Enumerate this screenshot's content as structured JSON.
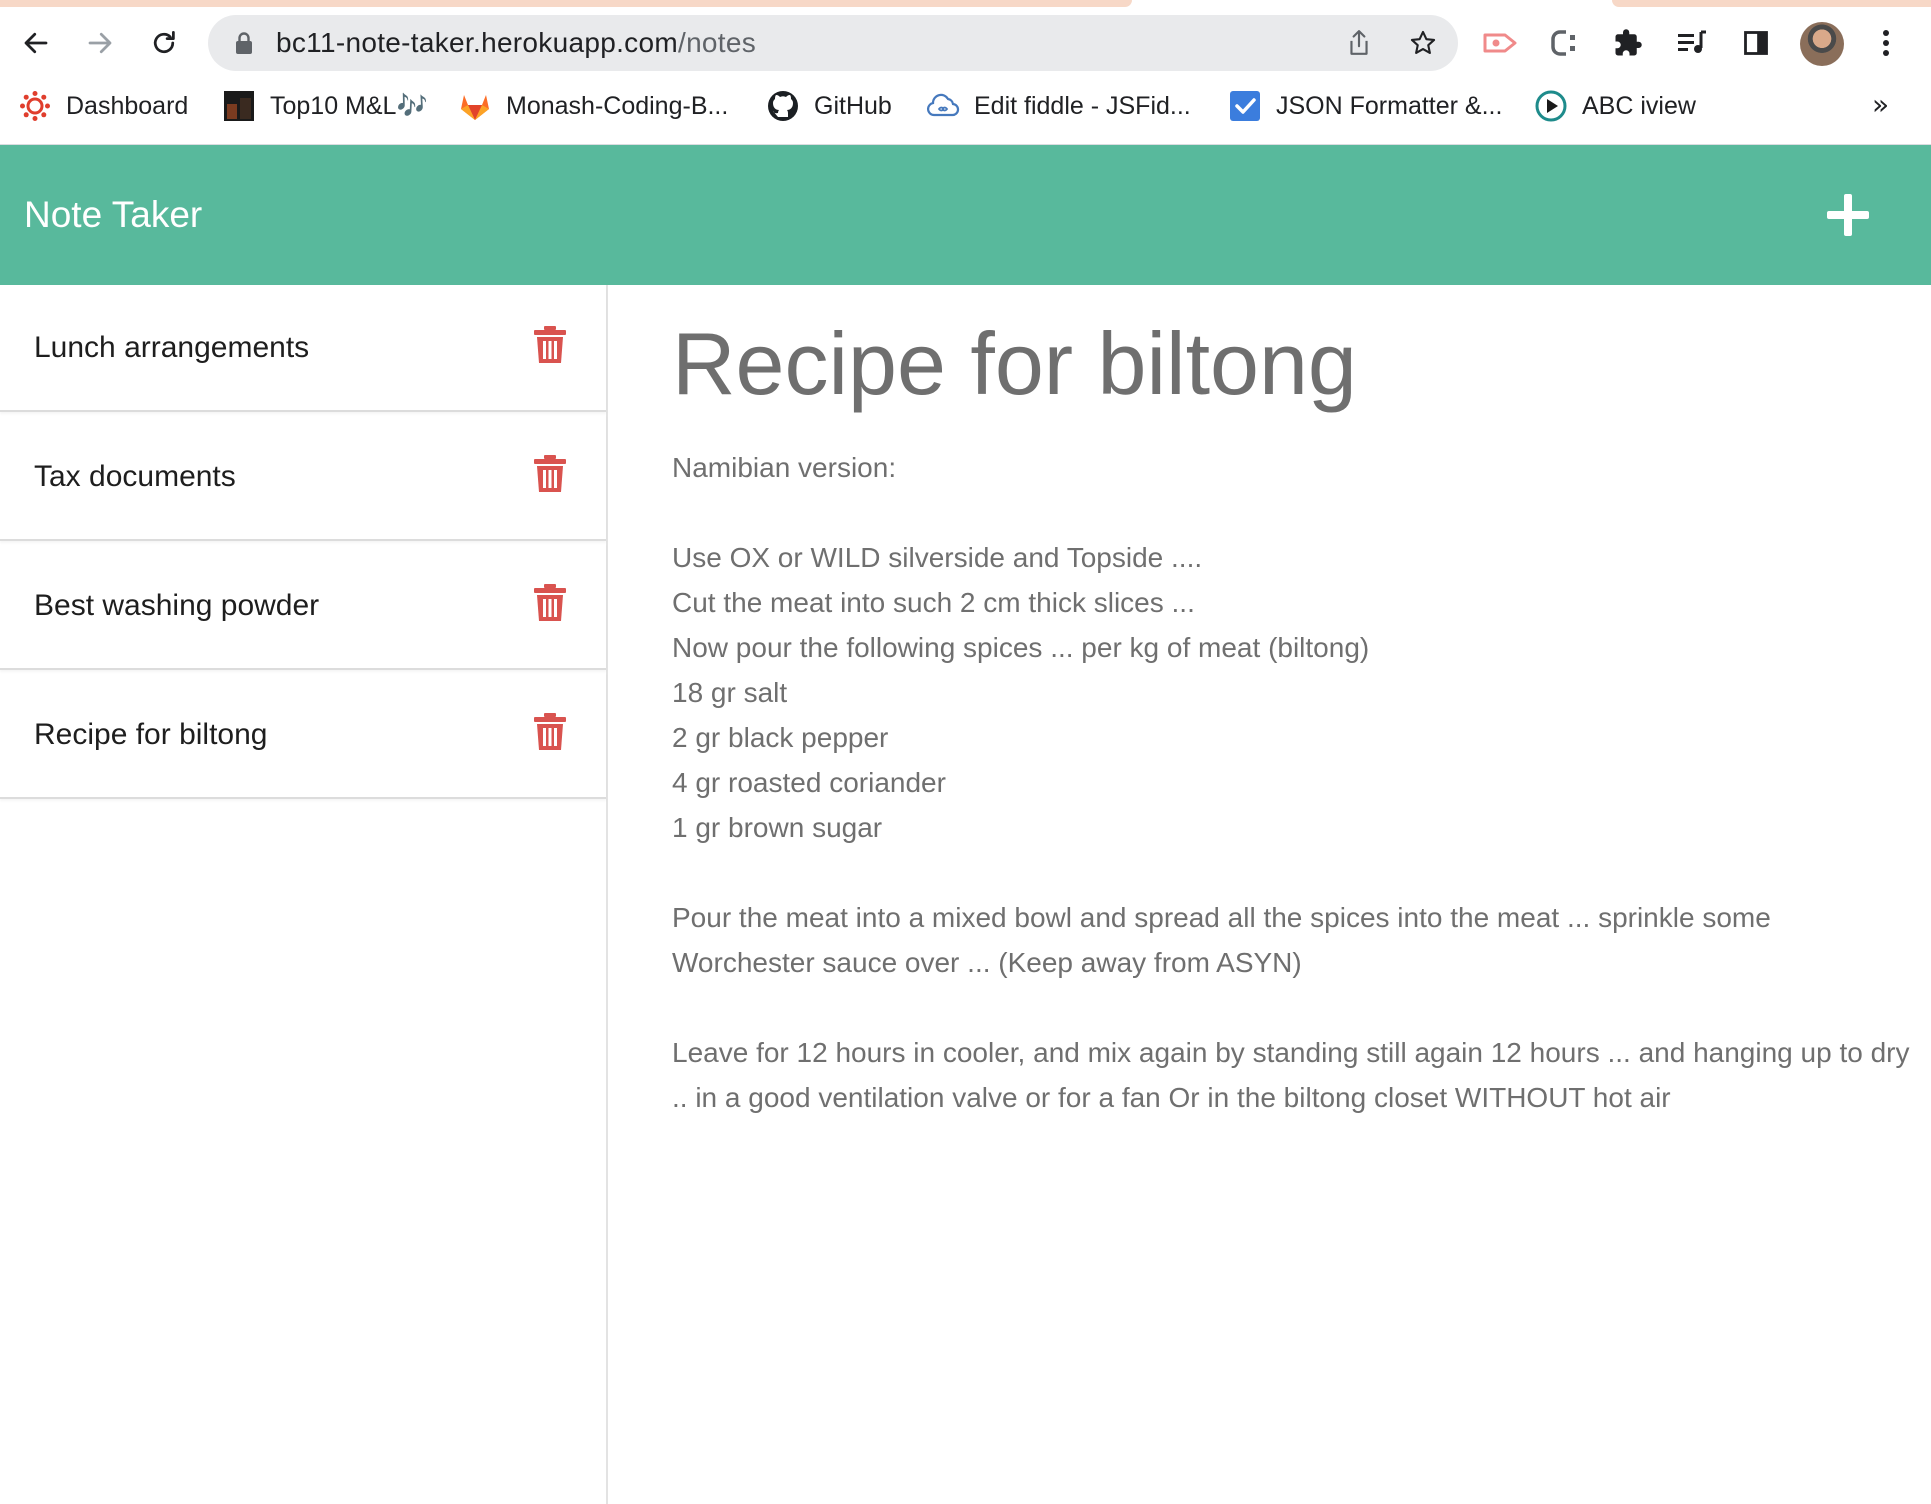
{
  "browser": {
    "url_host": "bc11-note-taker.herokuapp.com",
    "url_path": "/notes",
    "bookmarks": [
      {
        "label": "Dashboard",
        "icon": "canvas-lms-icon",
        "color": "#e03e2d"
      },
      {
        "label": "Top10 M&L🎶",
        "icon": "thumbnail-icon",
        "color": "#222222"
      },
      {
        "label": "Monash-Coding-B...",
        "icon": "gitlab-icon",
        "color": "#e2432a"
      },
      {
        "label": "GitHub",
        "icon": "github-icon",
        "color": "#1b1f23"
      },
      {
        "label": "Edit fiddle - JSFid...",
        "icon": "jsfiddle-icon",
        "color": "#4679bd"
      },
      {
        "label": "JSON Formatter &...",
        "icon": "checkbox-icon",
        "color": "#3b7ddd"
      },
      {
        "label": "ABC iview",
        "icon": "abc-iview-icon",
        "color": "#1e8b8b"
      }
    ],
    "overflow_label": "»"
  },
  "app": {
    "title": "Note Taker",
    "accent_color": "#58b99c",
    "delete_color": "#d9534f"
  },
  "notes": [
    {
      "title": "Lunch arrangements"
    },
    {
      "title": "Tax documents"
    },
    {
      "title": "Best washing powder"
    },
    {
      "title": "Recipe for biltong"
    }
  ],
  "active_note": {
    "title": "Recipe for biltong",
    "text": "Namibian version:\n\nUse OX or WILD silverside and Topside ....\nCut the meat into such 2 cm thick slices ...\nNow pour the following spices ... per kg of meat (biltong)\n18 gr salt\n2 gr black pepper\n4 gr roasted coriander\n1 gr brown sugar\n\nPour the meat into a mixed bowl and spread all the spices into the meat ... sprinkle some Worchester sauce over ... (Keep away from ASYN)\n\nLeave for 12 hours in cooler, and mix again by standing still again 12 hours ... and hanging up to dry .. in a good ventilation valve or for a fan Or in the biltong closet WITHOUT hot air"
  }
}
